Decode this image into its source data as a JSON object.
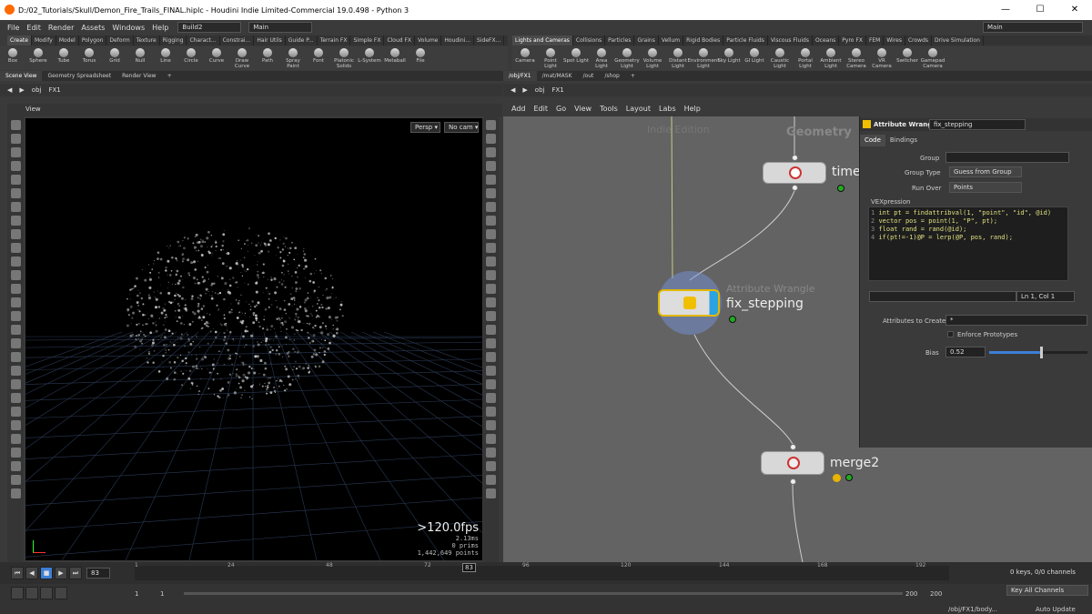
{
  "window": {
    "title": "D:/02_Tutorials/Skull/Demon_Fire_Trails_FINAL.hiplc - Houdini Indie Limited-Commercial 19.0.498 - Python 3",
    "min": "—",
    "max": "☐",
    "close": "✕"
  },
  "menu": [
    "File",
    "Edit",
    "Render",
    "Assets",
    "Windows",
    "Help"
  ],
  "desktop_left": "Build2",
  "desktop_mid": "Main",
  "desktop_right": "Main",
  "shelf_tabs_left": [
    "Create",
    "Modify",
    "Model",
    "Polygon",
    "Deform",
    "Texture",
    "Rigging",
    "Charact...",
    "Constrai...",
    "Hair Utils",
    "Guide P...",
    "Terrain FX",
    "Simple FX",
    "Cloud FX",
    "Volume",
    "Houdini...",
    "SideFX..."
  ],
  "shelf_tabs_right": [
    "Lights and Cameras",
    "Collisions",
    "Particles",
    "Grains",
    "Vellum",
    "Rigid Bodies",
    "Particle Fluids",
    "Viscous Fluids",
    "Oceans",
    "Pyro FX",
    "FEM",
    "Wires",
    "Crowds",
    "Drive Simulation"
  ],
  "tools_left": [
    "Box",
    "Sphere",
    "Tube",
    "Torus",
    "Grid",
    "Null",
    "Line",
    "Circle",
    "Curve",
    "Draw Curve",
    "Path",
    "Spray Paint",
    "Font",
    "Platonic Solids",
    "L-System",
    "Metaball",
    "File"
  ],
  "tools_right": [
    "Camera",
    "Point Light",
    "Spot Light",
    "Area Light",
    "Geometry Light",
    "Volume Light",
    "Distant Light",
    "Environment Light",
    "Sky Light",
    "GI Light",
    "Caustic Light",
    "Portal Light",
    "Ambient Light",
    "Stereo Camera",
    "VR Camera",
    "Switcher",
    "Gamepad Camera"
  ],
  "left_pane_tabs": [
    "Scene View",
    "Geometry Spreadsheet",
    "Render View"
  ],
  "right_pane_tabs": [
    "/obj/FX1",
    "/mat/MASK",
    "/out",
    "/shop"
  ],
  "left_path": {
    "root": "obj",
    "node": "FX1"
  },
  "right_path": {
    "root": "obj",
    "node": "FX1"
  },
  "viewport": {
    "label": "View",
    "persp": "Persp ▾",
    "cam": "No cam ▾",
    "fps": ">120.0fps",
    "ms": "2.13ms",
    "prims": "0  prims",
    "points": "1,442,649 points"
  },
  "net_menu": [
    "Add",
    "Edit",
    "Go",
    "View",
    "Tools",
    "Layout",
    "Labs",
    "Help"
  ],
  "network": {
    "watermark": "Indie Edition",
    "context": "Geometry",
    "node_time": "time",
    "node_wrangle_type": "Attribute Wrangle",
    "node_wrangle": "fix_stepping",
    "node_merge": "merge2"
  },
  "params": {
    "header_type": "Attribute Wrangle",
    "header_name": "fix_stepping",
    "tabs": [
      "Code",
      "Bindings"
    ],
    "group_label": "Group",
    "group_type_label": "Group Type",
    "group_type_value": "Guess from Group",
    "run_over_label": "Run Over",
    "run_over_value": "Points",
    "vex_label": "VEXpression",
    "code_lines": [
      "int pt = findattribval(1, \"point\", \"id\", @id)",
      "vector pos = point(1, \"P\", pt);",
      "float rand = rand(@id);",
      "if(pt!=-1)@P = lerp(@P, pos, rand);"
    ],
    "cursor": "Ln 1, Col 1",
    "attr_create_label": "Attributes to Create",
    "attr_create_value": "*",
    "enforce_label": "Enforce Prototypes",
    "bias_label": "Bias",
    "bias_value": "0.52",
    "bias_fraction": 0.52
  },
  "timeline": {
    "frame": "83",
    "current_marker": "83",
    "ticks": [
      "1",
      "24",
      "48",
      "72",
      "96",
      "120",
      "144",
      "168",
      "192"
    ],
    "keys": "0 keys, 0/0 channels",
    "key_all": "Key All Channels",
    "start": "1",
    "start2": "1",
    "end": "200",
    "end2": "200",
    "path": "/obj/FX1/body...",
    "update": "Auto Update"
  }
}
